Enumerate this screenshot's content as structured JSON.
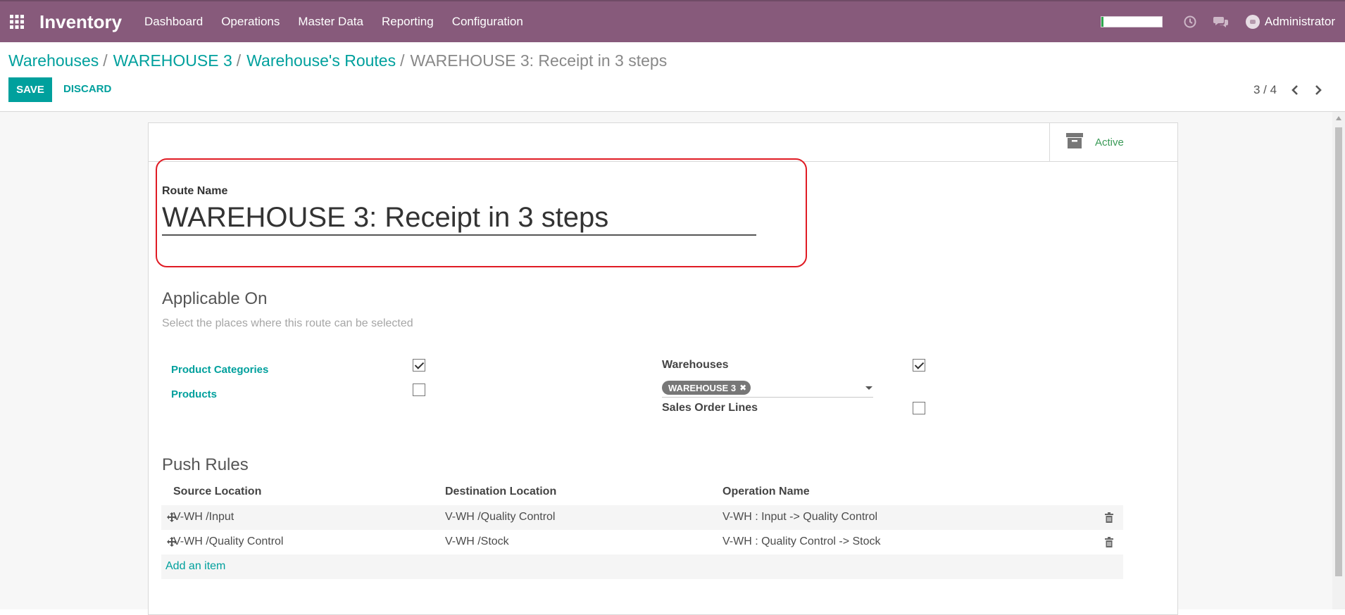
{
  "app": {
    "name": "Inventory",
    "menu": [
      "Dashboard",
      "Operations",
      "Master Data",
      "Reporting",
      "Configuration"
    ],
    "user": "Administrator",
    "progress_fraction": 0.04
  },
  "breadcrumb": {
    "items": [
      "Warehouses",
      "WAREHOUSE 3",
      "Warehouse's Routes"
    ],
    "current": "WAREHOUSE 3: Receipt in 3 steps"
  },
  "toolbar": {
    "save_label": "SAVE",
    "discard_label": "DISCARD",
    "pager": "3 / 4"
  },
  "form": {
    "active_label": "Active",
    "route_name_label": "Route Name",
    "route_name_value": "WAREHOUSE 3: Receipt in 3 steps",
    "applicable_on": {
      "title": "Applicable On",
      "hint": "Select the places where this route can be selected",
      "product_categories_label": "Product Categories",
      "product_categories_checked": true,
      "products_label": "Products",
      "products_checked": false,
      "warehouses_label": "Warehouses",
      "warehouses_checked": true,
      "warehouse_tag": "WAREHOUSE 3",
      "sales_order_lines_label": "Sales Order Lines",
      "sales_order_lines_checked": false
    },
    "push_rules": {
      "title": "Push Rules",
      "columns": [
        "Source Location",
        "Destination Location",
        "Operation Name"
      ],
      "rows": [
        {
          "source": "V-WH /Input",
          "destination": "V-WH /Quality Control",
          "operation": "V-WH : Input -> Quality Control"
        },
        {
          "source": "V-WH /Quality Control",
          "destination": "V-WH /Stock",
          "operation": "V-WH : Quality Control -> Stock"
        }
      ],
      "add_label": "Add an item"
    }
  },
  "colors": {
    "navbar": "#875a7b",
    "accent": "#00a09d",
    "highlight": "#e01b24"
  },
  "icons": [
    "apps-grid-icon",
    "clock-icon",
    "chat-icon",
    "avatar-icon",
    "chevron-left-icon",
    "chevron-right-icon",
    "archive-icon",
    "drag-handle-icon",
    "trash-icon",
    "tag-remove-icon",
    "dropdown-caret-icon"
  ]
}
